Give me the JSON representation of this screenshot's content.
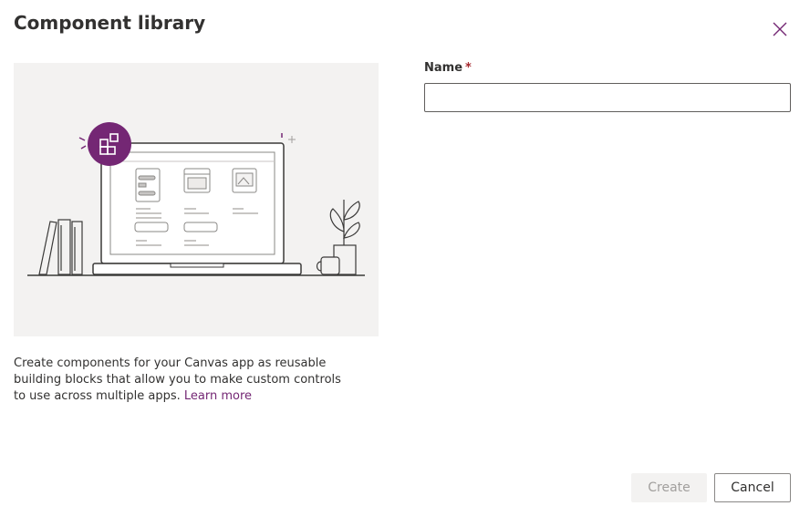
{
  "dialog": {
    "title": "Component library",
    "close_icon": "close-icon"
  },
  "illustration": {
    "icon": "component-library-illustration"
  },
  "description": {
    "text": "Create components for your Canvas app as reusable building blocks that allow you to make custom controls to use across multiple apps.",
    "link_label": "Learn more"
  },
  "form": {
    "name_label": "Name",
    "required_marker": "*",
    "name_value": "",
    "name_placeholder": ""
  },
  "actions": {
    "create_label": "Create",
    "cancel_label": "Cancel"
  },
  "colors": {
    "accent": "#742774",
    "required": "#a4262c",
    "illustration_bg": "#f3f2f1"
  }
}
